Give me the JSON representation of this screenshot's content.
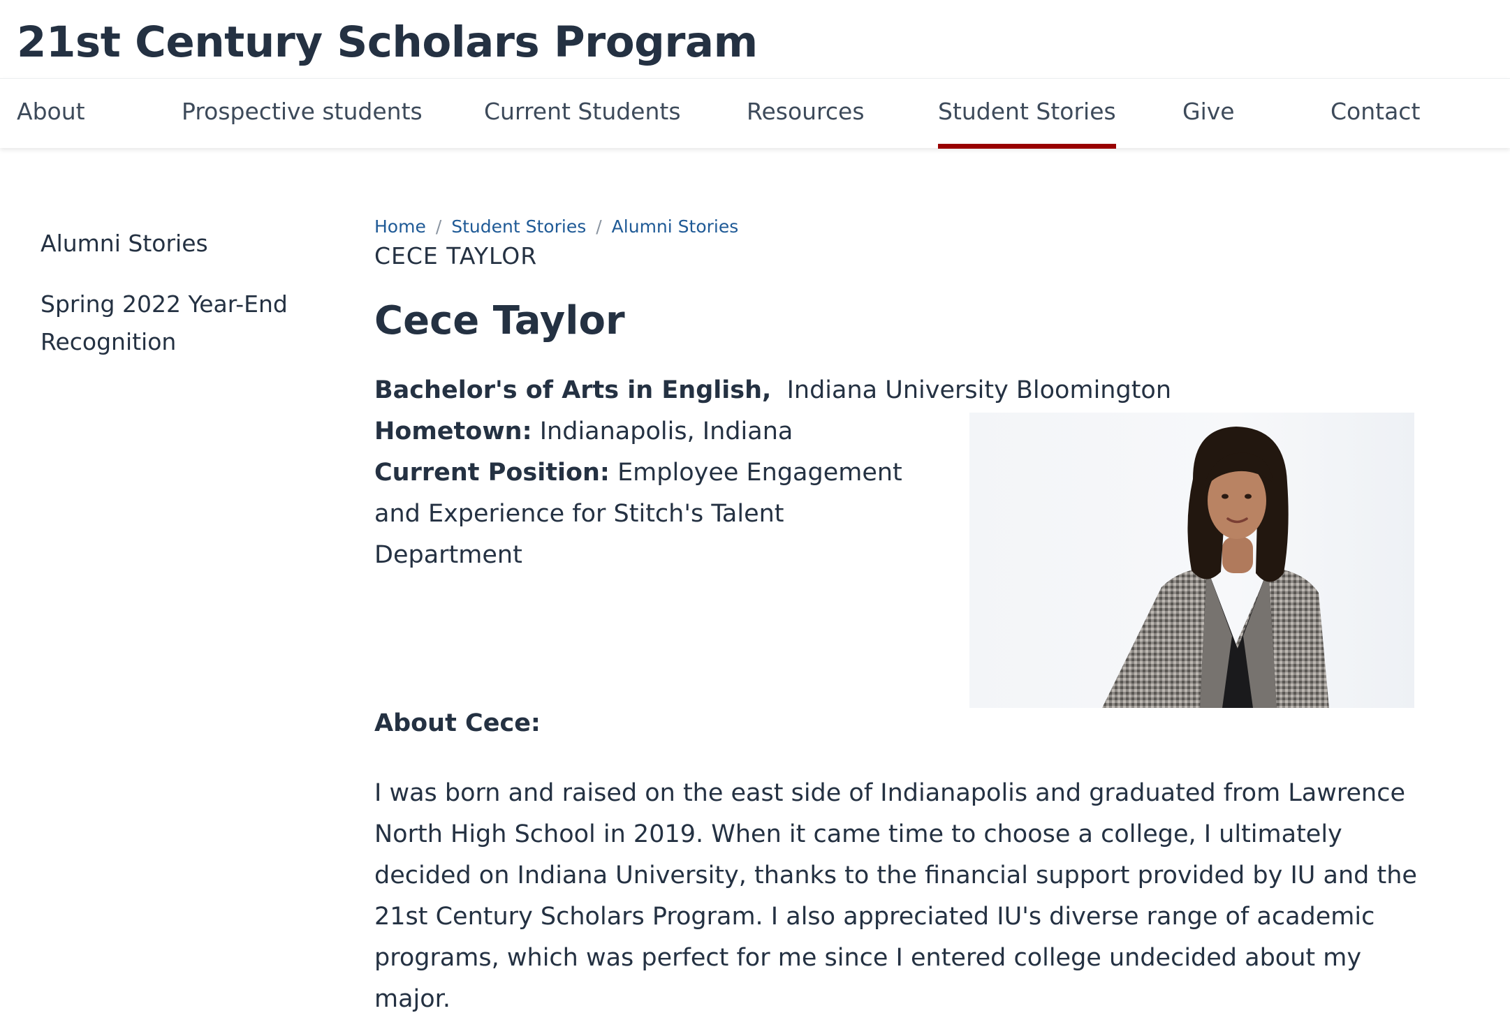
{
  "site": {
    "title": "21st Century Scholars Program"
  },
  "nav": {
    "about": "About",
    "prospective": "Prospective students",
    "current": "Current Students",
    "resources": "Resources",
    "stories": "Student Stories",
    "give": "Give",
    "contact": "Contact",
    "active": "Student Stories",
    "active_color": "#990000"
  },
  "sidebar": {
    "items": [
      {
        "label": "Alumni Stories"
      },
      {
        "label": "Spring 2022 Year-End Recognition"
      }
    ]
  },
  "breadcrumb": {
    "home": "Home",
    "stories": "Student Stories",
    "alumni": "Alumni Stories",
    "separator": "/",
    "current": "CECE TAYLOR"
  },
  "profile": {
    "name": "Cece Taylor",
    "degree_label": "Bachelor's of Arts in English,",
    "degree_value": "Indiana University Bloomington",
    "hometown_label": "Hometown:",
    "hometown_value": "Indianapolis, Indiana",
    "position_label": "Current Position:",
    "position_value": "Employee Engagement and Experience for Stitch's Talent Department",
    "photo_icon": "portrait-photo"
  },
  "about": {
    "heading": "About Cece:",
    "body": "I was born and raised on the east side of Indianapolis and graduated from Lawrence North High School in 2019. When it came time to choose a college, I ultimately decided on Indiana University, thanks to the financial support provided by IU and the 21st Century Scholars Program. I also appreciated IU's diverse range of academic programs, which was perfect for me since I entered college undecided about my major."
  }
}
